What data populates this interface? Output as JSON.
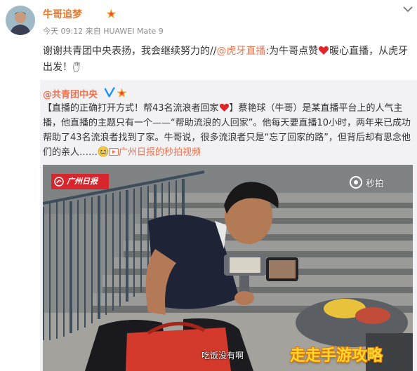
{
  "user": {
    "name": "牛哥追梦"
  },
  "post": {
    "meta": "今天 09:12 来自 HUAWEI Mate 9",
    "text_a": "谢谢共青团中央表扬，我会继续努力的//",
    "mention": "@虎牙直播",
    "text_b": ":为牛哥点赞",
    "text_c": "暖心直播，从虎牙出发！"
  },
  "repost": {
    "username": "@共青团中央",
    "text_a": "【直播的正确打开方式！帮43名流浪者回家",
    "text_b": "】蔡艳球（牛哥）是某直播平台上的人气主播，他直播的主题只有一个——“帮助流浪的人回家”。他每天要直播10小时，两年来已成功帮助了43名流浪者找到了家。牛哥说，很多流浪者只是“忘了回家的路”，但背后却有思念他们的亲人……",
    "video_link": "广州日报的秒拍视频"
  },
  "video": {
    "brand_label": "广州日报",
    "platform_label": "秒拍",
    "subtitle": "吃饭没有啊"
  },
  "watermark": "走走手游攻略",
  "colors": {
    "link": "#eb7350",
    "username": "#e8782a",
    "verified": "#1e90ff",
    "brand": "#d7262c"
  }
}
